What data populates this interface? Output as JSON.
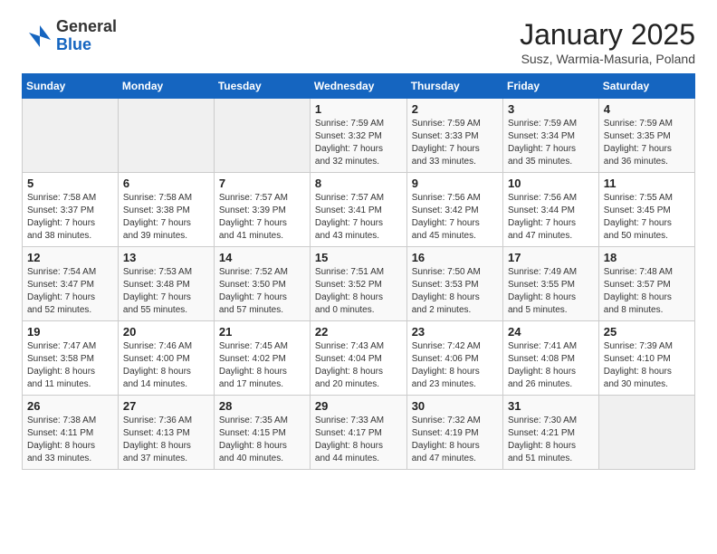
{
  "logo": {
    "general": "General",
    "blue": "Blue"
  },
  "header": {
    "title": "January 2025",
    "subtitle": "Susz, Warmia-Masuria, Poland"
  },
  "weekdays": [
    "Sunday",
    "Monday",
    "Tuesday",
    "Wednesday",
    "Thursday",
    "Friday",
    "Saturday"
  ],
  "weeks": [
    [
      {
        "day": "",
        "info": ""
      },
      {
        "day": "",
        "info": ""
      },
      {
        "day": "",
        "info": ""
      },
      {
        "day": "1",
        "info": "Sunrise: 7:59 AM\nSunset: 3:32 PM\nDaylight: 7 hours\nand 32 minutes."
      },
      {
        "day": "2",
        "info": "Sunrise: 7:59 AM\nSunset: 3:33 PM\nDaylight: 7 hours\nand 33 minutes."
      },
      {
        "day": "3",
        "info": "Sunrise: 7:59 AM\nSunset: 3:34 PM\nDaylight: 7 hours\nand 35 minutes."
      },
      {
        "day": "4",
        "info": "Sunrise: 7:59 AM\nSunset: 3:35 PM\nDaylight: 7 hours\nand 36 minutes."
      }
    ],
    [
      {
        "day": "5",
        "info": "Sunrise: 7:58 AM\nSunset: 3:37 PM\nDaylight: 7 hours\nand 38 minutes."
      },
      {
        "day": "6",
        "info": "Sunrise: 7:58 AM\nSunset: 3:38 PM\nDaylight: 7 hours\nand 39 minutes."
      },
      {
        "day": "7",
        "info": "Sunrise: 7:57 AM\nSunset: 3:39 PM\nDaylight: 7 hours\nand 41 minutes."
      },
      {
        "day": "8",
        "info": "Sunrise: 7:57 AM\nSunset: 3:41 PM\nDaylight: 7 hours\nand 43 minutes."
      },
      {
        "day": "9",
        "info": "Sunrise: 7:56 AM\nSunset: 3:42 PM\nDaylight: 7 hours\nand 45 minutes."
      },
      {
        "day": "10",
        "info": "Sunrise: 7:56 AM\nSunset: 3:44 PM\nDaylight: 7 hours\nand 47 minutes."
      },
      {
        "day": "11",
        "info": "Sunrise: 7:55 AM\nSunset: 3:45 PM\nDaylight: 7 hours\nand 50 minutes."
      }
    ],
    [
      {
        "day": "12",
        "info": "Sunrise: 7:54 AM\nSunset: 3:47 PM\nDaylight: 7 hours\nand 52 minutes."
      },
      {
        "day": "13",
        "info": "Sunrise: 7:53 AM\nSunset: 3:48 PM\nDaylight: 7 hours\nand 55 minutes."
      },
      {
        "day": "14",
        "info": "Sunrise: 7:52 AM\nSunset: 3:50 PM\nDaylight: 7 hours\nand 57 minutes."
      },
      {
        "day": "15",
        "info": "Sunrise: 7:51 AM\nSunset: 3:52 PM\nDaylight: 8 hours\nand 0 minutes."
      },
      {
        "day": "16",
        "info": "Sunrise: 7:50 AM\nSunset: 3:53 PM\nDaylight: 8 hours\nand 2 minutes."
      },
      {
        "day": "17",
        "info": "Sunrise: 7:49 AM\nSunset: 3:55 PM\nDaylight: 8 hours\nand 5 minutes."
      },
      {
        "day": "18",
        "info": "Sunrise: 7:48 AM\nSunset: 3:57 PM\nDaylight: 8 hours\nand 8 minutes."
      }
    ],
    [
      {
        "day": "19",
        "info": "Sunrise: 7:47 AM\nSunset: 3:58 PM\nDaylight: 8 hours\nand 11 minutes."
      },
      {
        "day": "20",
        "info": "Sunrise: 7:46 AM\nSunset: 4:00 PM\nDaylight: 8 hours\nand 14 minutes."
      },
      {
        "day": "21",
        "info": "Sunrise: 7:45 AM\nSunset: 4:02 PM\nDaylight: 8 hours\nand 17 minutes."
      },
      {
        "day": "22",
        "info": "Sunrise: 7:43 AM\nSunset: 4:04 PM\nDaylight: 8 hours\nand 20 minutes."
      },
      {
        "day": "23",
        "info": "Sunrise: 7:42 AM\nSunset: 4:06 PM\nDaylight: 8 hours\nand 23 minutes."
      },
      {
        "day": "24",
        "info": "Sunrise: 7:41 AM\nSunset: 4:08 PM\nDaylight: 8 hours\nand 26 minutes."
      },
      {
        "day": "25",
        "info": "Sunrise: 7:39 AM\nSunset: 4:10 PM\nDaylight: 8 hours\nand 30 minutes."
      }
    ],
    [
      {
        "day": "26",
        "info": "Sunrise: 7:38 AM\nSunset: 4:11 PM\nDaylight: 8 hours\nand 33 minutes."
      },
      {
        "day": "27",
        "info": "Sunrise: 7:36 AM\nSunset: 4:13 PM\nDaylight: 8 hours\nand 37 minutes."
      },
      {
        "day": "28",
        "info": "Sunrise: 7:35 AM\nSunset: 4:15 PM\nDaylight: 8 hours\nand 40 minutes."
      },
      {
        "day": "29",
        "info": "Sunrise: 7:33 AM\nSunset: 4:17 PM\nDaylight: 8 hours\nand 44 minutes."
      },
      {
        "day": "30",
        "info": "Sunrise: 7:32 AM\nSunset: 4:19 PM\nDaylight: 8 hours\nand 47 minutes."
      },
      {
        "day": "31",
        "info": "Sunrise: 7:30 AM\nSunset: 4:21 PM\nDaylight: 8 hours\nand 51 minutes."
      },
      {
        "day": "",
        "info": ""
      }
    ]
  ]
}
